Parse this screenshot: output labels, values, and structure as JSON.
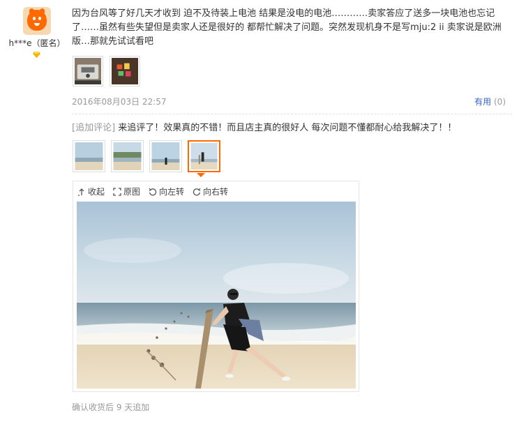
{
  "user": {
    "name": "h***e（匿名）",
    "avatar_icon": "taobao-mascot-avatar",
    "rank_icon": "diamond-rank-icon"
  },
  "review": {
    "text": "因为台风等了好几天才收到 迫不及待装上电池 结果是没电的电池…………卖家答应了送多一块电池也忘记了……虽然有些失望但是卖家人还是很好的 都帮忙解决了问题。突然发现机身不是写mju:2 ii 卖家说是欧洲版…那就先试试看吧",
    "date": "2016年08月03日 22:57",
    "useful_label": "有用",
    "useful_count": "(0)"
  },
  "append": {
    "tag": "[追加评论]",
    "text": "来追评了！效果真的不错！而且店主真的很好人 每次问题不懂都耐心给我解决了！！"
  },
  "viewer": {
    "collapse_label": "收起",
    "original_label": "原图",
    "rotate_left_label": "向左转",
    "rotate_right_label": "向右转"
  },
  "footer": {
    "text": "确认收货后 9 天追加"
  },
  "colors": {
    "accent": "#ff6a00",
    "link": "#3a66c9",
    "muted": "#999999"
  }
}
